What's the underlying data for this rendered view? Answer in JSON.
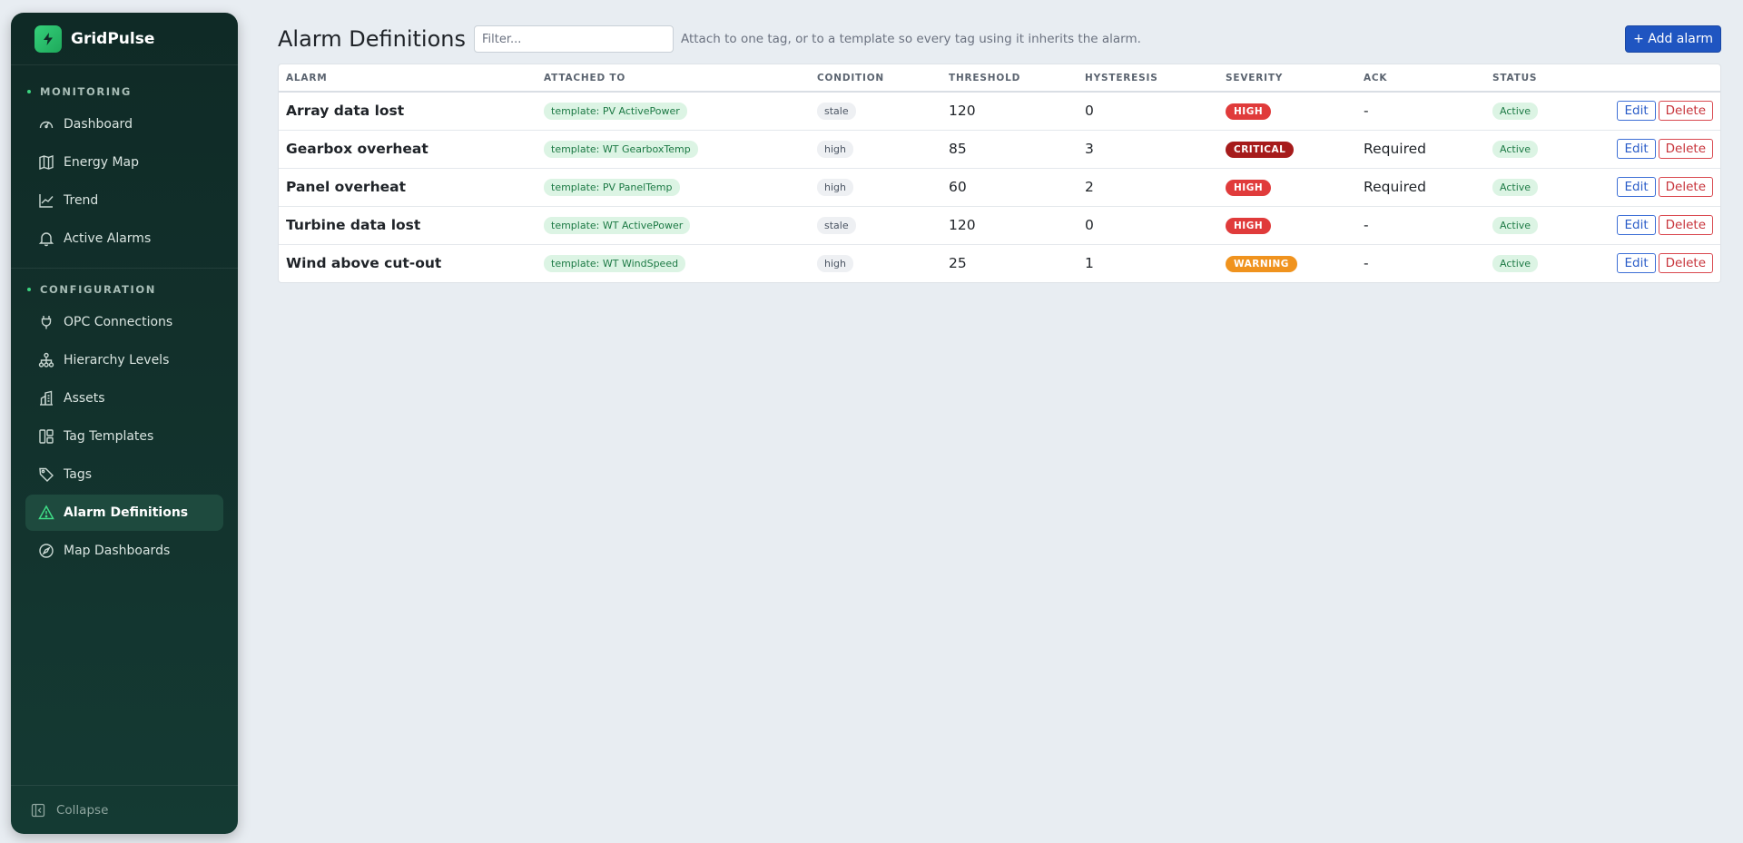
{
  "brand": {
    "name": "GridPulse"
  },
  "sidebar": {
    "sections": [
      {
        "label": "MONITORING",
        "items": [
          {
            "label": "Dashboard",
            "icon": "gauge-icon"
          },
          {
            "label": "Energy Map",
            "icon": "map-icon"
          },
          {
            "label": "Trend",
            "icon": "trend-icon"
          },
          {
            "label": "Active Alarms",
            "icon": "bell-icon"
          }
        ]
      },
      {
        "label": "CONFIGURATION",
        "items": [
          {
            "label": "OPC Connections",
            "icon": "plug-icon"
          },
          {
            "label": "Hierarchy Levels",
            "icon": "hierarchy-icon"
          },
          {
            "label": "Assets",
            "icon": "building-icon"
          },
          {
            "label": "Tag Templates",
            "icon": "template-icon"
          },
          {
            "label": "Tags",
            "icon": "tag-icon"
          },
          {
            "label": "Alarm Definitions",
            "icon": "warning-icon",
            "active": true
          },
          {
            "label": "Map Dashboards",
            "icon": "compass-icon"
          }
        ]
      }
    ],
    "collapse_label": "Collapse"
  },
  "header": {
    "title": "Alarm Definitions",
    "filter_placeholder": "Filter...",
    "hint": "Attach to one tag, or to a template so every tag using it inherits the alarm.",
    "add_label": "+ Add alarm"
  },
  "table": {
    "columns": [
      "ALARM",
      "ATTACHED TO",
      "CONDITION",
      "THRESHOLD",
      "HYSTERESIS",
      "SEVERITY",
      "ACK",
      "STATUS",
      ""
    ],
    "rows": [
      {
        "alarm": "Array data lost",
        "attached": "template: PV ActivePower",
        "condition": "stale",
        "threshold": "120",
        "hysteresis": "0",
        "severity": "HIGH",
        "ack": "-",
        "status": "Active"
      },
      {
        "alarm": "Gearbox overheat",
        "attached": "template: WT GearboxTemp",
        "condition": "high",
        "threshold": "85",
        "hysteresis": "3",
        "severity": "CRITICAL",
        "ack": "Required",
        "status": "Active"
      },
      {
        "alarm": "Panel overheat",
        "attached": "template: PV PanelTemp",
        "condition": "high",
        "threshold": "60",
        "hysteresis": "2",
        "severity": "HIGH",
        "ack": "Required",
        "status": "Active"
      },
      {
        "alarm": "Turbine data lost",
        "attached": "template: WT ActivePower",
        "condition": "stale",
        "threshold": "120",
        "hysteresis": "0",
        "severity": "HIGH",
        "ack": "-",
        "status": "Active"
      },
      {
        "alarm": "Wind above cut-out",
        "attached": "template: WT WindSpeed",
        "condition": "high",
        "threshold": "25",
        "hysteresis": "1",
        "severity": "WARNING",
        "ack": "-",
        "status": "Active"
      }
    ],
    "edit_label": "Edit",
    "delete_label": "Delete"
  },
  "colors": {
    "HIGH": "#e03b3b",
    "CRITICAL": "#a61b1b",
    "WARNING": "#f0931e",
    "accent": "#1f55c1"
  }
}
